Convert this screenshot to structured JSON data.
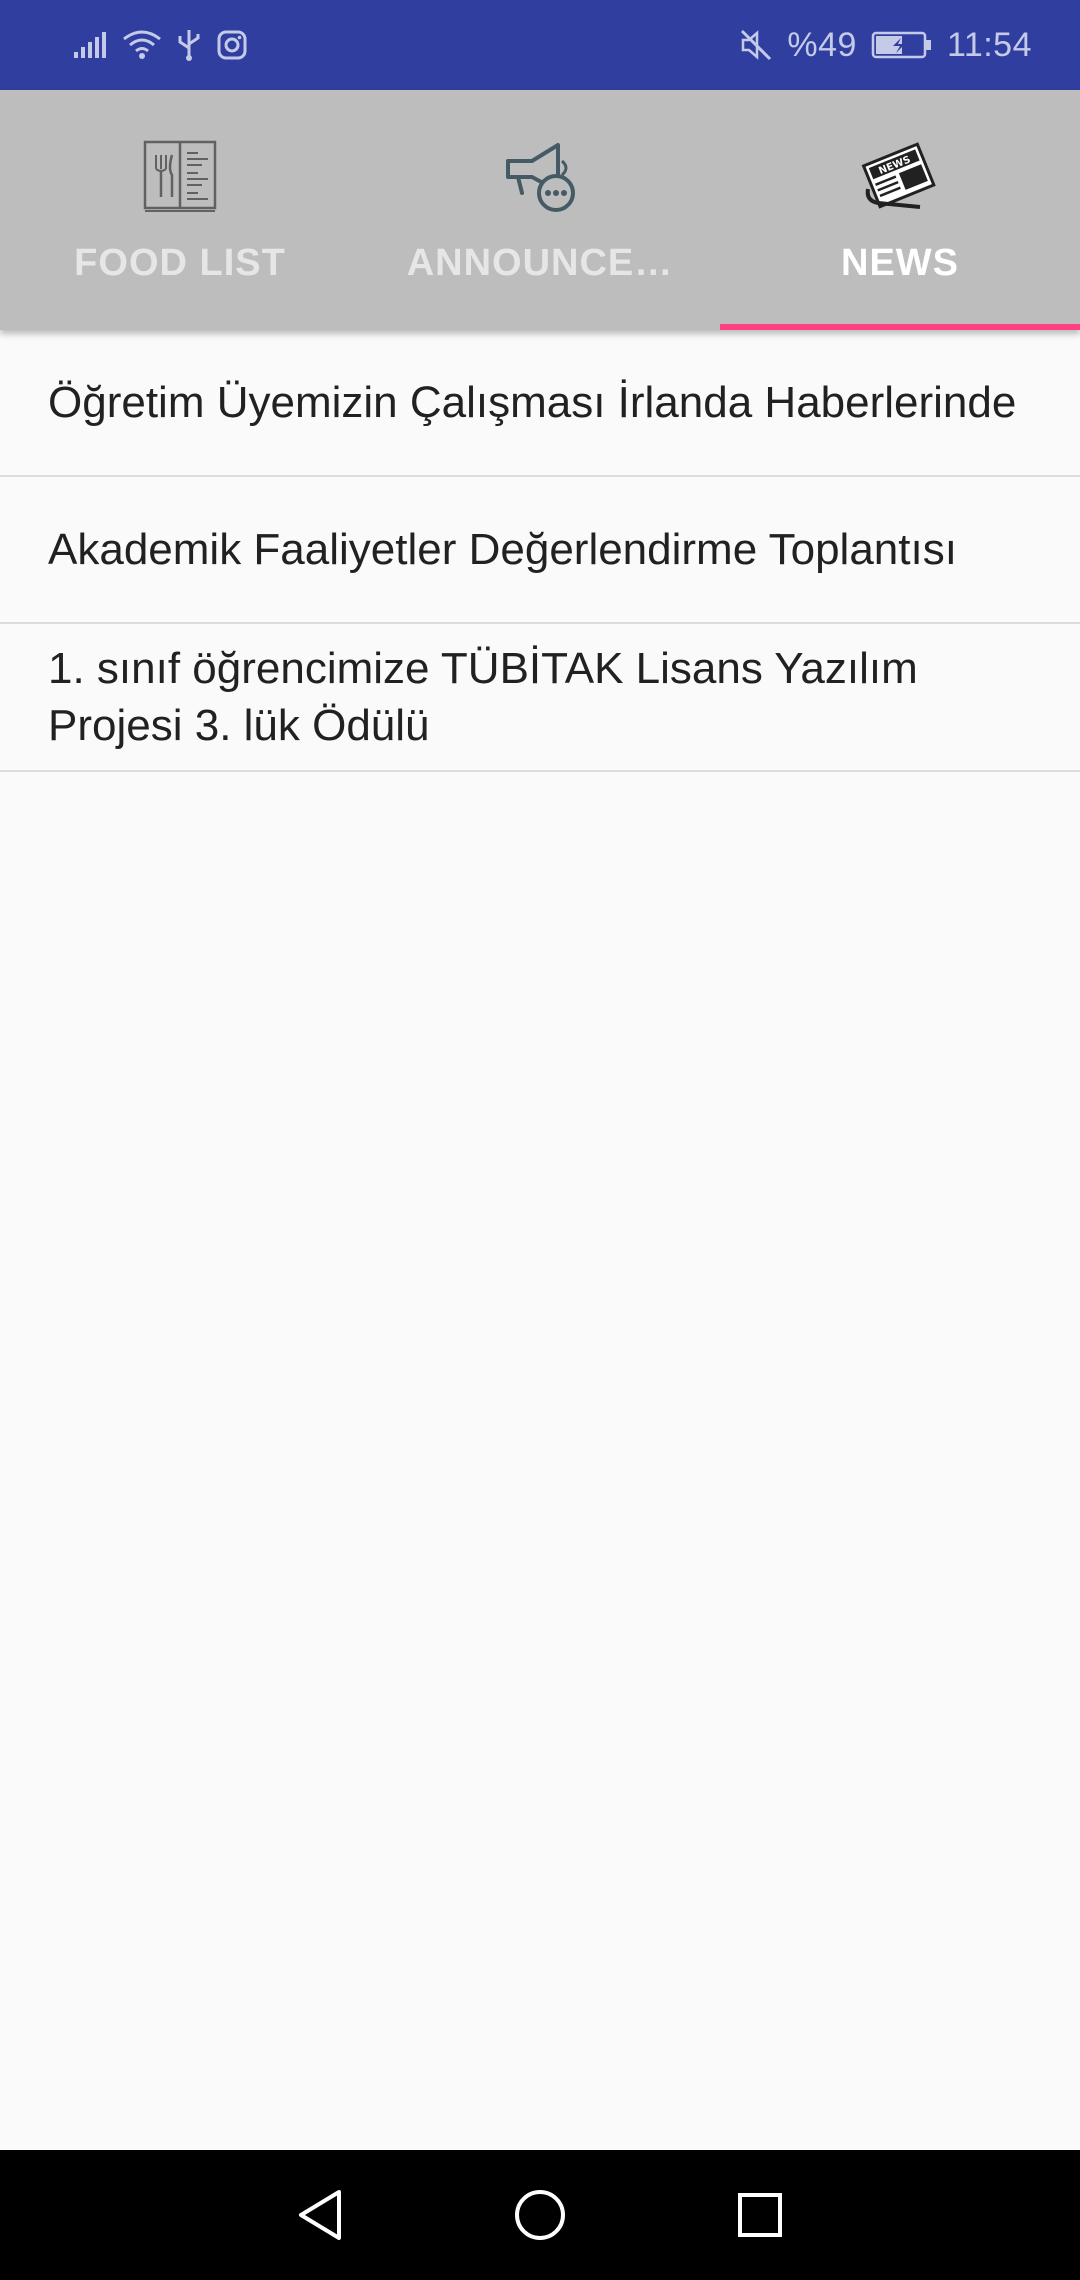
{
  "status_bar": {
    "battery_percent": "%49",
    "time": "11:54",
    "left_icons": [
      "signal-icon",
      "wifi-icon",
      "usb-icon",
      "instagram-icon"
    ],
    "right_icons": [
      "mute-icon",
      "battery-charging-icon"
    ]
  },
  "tabs": [
    {
      "label": "FOOD LIST",
      "icon": "menu-book-icon",
      "active": false
    },
    {
      "label": "ANNOUNCE…",
      "icon": "megaphone-icon",
      "active": false
    },
    {
      "label": "NEWS",
      "icon": "newspaper-icon",
      "active": true
    }
  ],
  "news": [
    {
      "title": "Öğretim Üyemizin Çalışması İrlanda Haberlerinde"
    },
    {
      "title": "Akademik Faaliyetler Değerlendirme Toplantısı"
    },
    {
      "title": "1. sınıf öğrencimize TÜBİTAK Lisans Yazılım Projesi 3. lük Ödülü"
    }
  ],
  "nav_bar": {
    "buttons": [
      "back-icon",
      "home-icon",
      "recents-icon"
    ]
  },
  "colors": {
    "status_bar": "#303f9f",
    "tab_bar": "#bdbdbd",
    "tab_indicator": "#ff4081",
    "background": "#fafafa"
  }
}
